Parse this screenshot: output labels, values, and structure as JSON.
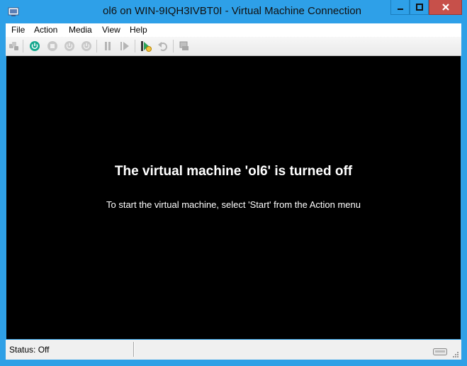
{
  "window": {
    "title": "ol6 on WIN-9IQH3IVBT0I - Virtual Machine Connection"
  },
  "menu": {
    "file": "File",
    "action": "Action",
    "media": "Media",
    "view": "View",
    "help": "Help"
  },
  "toolbar": {
    "icons": [
      "ctrl-alt-del-icon",
      "start-icon",
      "turn-off-icon",
      "shut-down-icon",
      "save-icon",
      "pause-icon",
      "reset-icon",
      "checkpoint-icon",
      "revert-icon",
      "enhanced-session-icon"
    ]
  },
  "screen": {
    "title": "The virtual machine 'ol6' is turned off",
    "message": "To start the virtual machine, select 'Start' from the Action menu"
  },
  "status": {
    "text": "Status: Off"
  },
  "colors": {
    "titlebar": "#2ea0e8",
    "close": "#c7504a",
    "screen": "#000000",
    "start_icon": "#14a88e"
  }
}
